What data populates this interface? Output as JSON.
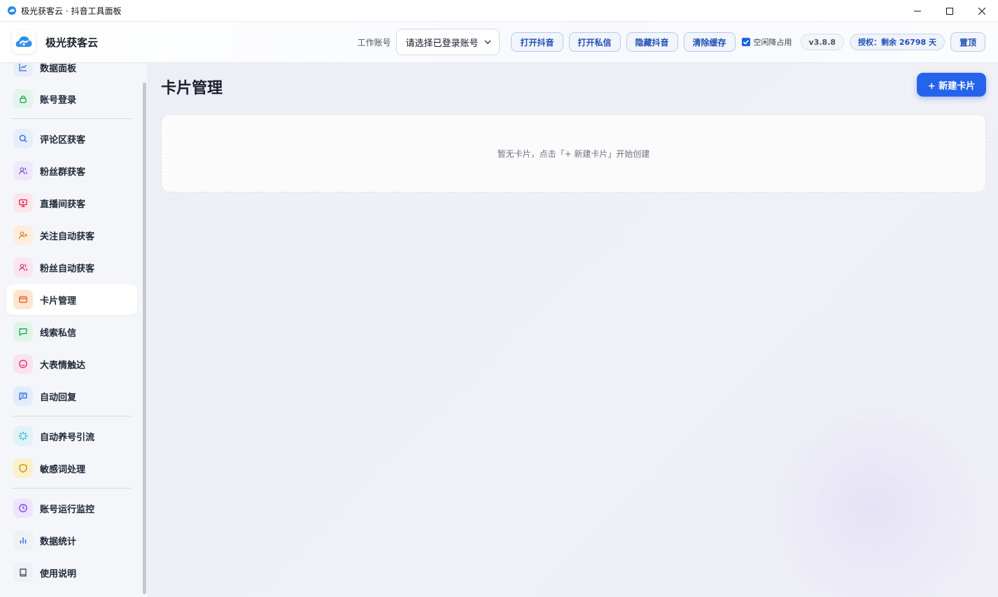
{
  "window": {
    "title": "极光获客云 · 抖音工具面板"
  },
  "header": {
    "brand": "极光获客云",
    "account_label": "工作账号",
    "account_select_value": "请选择已登录账号",
    "buttons": {
      "open_douyin": "打开抖音",
      "open_dm": "打开私信",
      "hide_douyin": "隐藏抖音",
      "clear_cache": "清除缓存",
      "pin_top": "置顶"
    },
    "idle_checkbox": {
      "label": "空闲降占用",
      "checked": true
    },
    "version": "v3.8.8",
    "license": "授权：剩余 26798 天"
  },
  "sidebar": {
    "items": [
      {
        "label": "数据面板",
        "icon": "chart-line-icon",
        "color": "#3b6fd4",
        "bg": "#e7eefb"
      },
      {
        "label": "账号登录",
        "icon": "lock-icon",
        "color": "#16a34a",
        "bg": "#e3f5ea"
      },
      {
        "label": "评论区获客",
        "icon": "search-icon",
        "color": "#2563eb",
        "bg": "#e6edfb"
      },
      {
        "label": "粉丝群获客",
        "icon": "users-icon",
        "color": "#7c4ddb",
        "bg": "#efe8fb"
      },
      {
        "label": "直播间获客",
        "icon": "monitor-icon",
        "color": "#e11d48",
        "bg": "#fde6ea"
      },
      {
        "label": "关注自动获客",
        "icon": "user-plus-icon",
        "color": "#ea7a12",
        "bg": "#fdeedd"
      },
      {
        "label": "粉丝自动获客",
        "icon": "users-icon",
        "color": "#db2777",
        "bg": "#fbe6f0"
      },
      {
        "label": "卡片管理",
        "icon": "card-icon",
        "color": "#ea580c",
        "bg": "#fde5d3",
        "active": true
      },
      {
        "label": "线索私信",
        "icon": "message-icon",
        "color": "#16a34a",
        "bg": "#dff4e6"
      },
      {
        "label": "大表情触达",
        "icon": "smile-icon",
        "color": "#db2777",
        "bg": "#fbe3ee"
      },
      {
        "label": "自动回复",
        "icon": "reply-icon",
        "color": "#2563eb",
        "bg": "#e3ecfb"
      },
      {
        "label": "自动养号引流",
        "icon": "loader-icon",
        "color": "#0ea5c4",
        "bg": "#e0f3f8"
      },
      {
        "label": "敏感词处理",
        "icon": "shield-icon",
        "color": "#ca8a04",
        "bg": "#fbf0c9"
      },
      {
        "label": "账号运行监控",
        "icon": "clock-icon",
        "color": "#7c3aed",
        "bg": "#ece5fb"
      },
      {
        "label": "数据统计",
        "icon": "bar-chart-icon",
        "color": "#2563eb",
        "bg": "#eef1f6"
      },
      {
        "label": "使用说明",
        "icon": "book-icon",
        "color": "#374151",
        "bg": "#eef1f6"
      }
    ]
  },
  "main": {
    "title": "卡片管理",
    "new_card_button": "+ 新建卡片",
    "empty_text": "暂无卡片，点击「+ 新建卡片」开始创建"
  }
}
